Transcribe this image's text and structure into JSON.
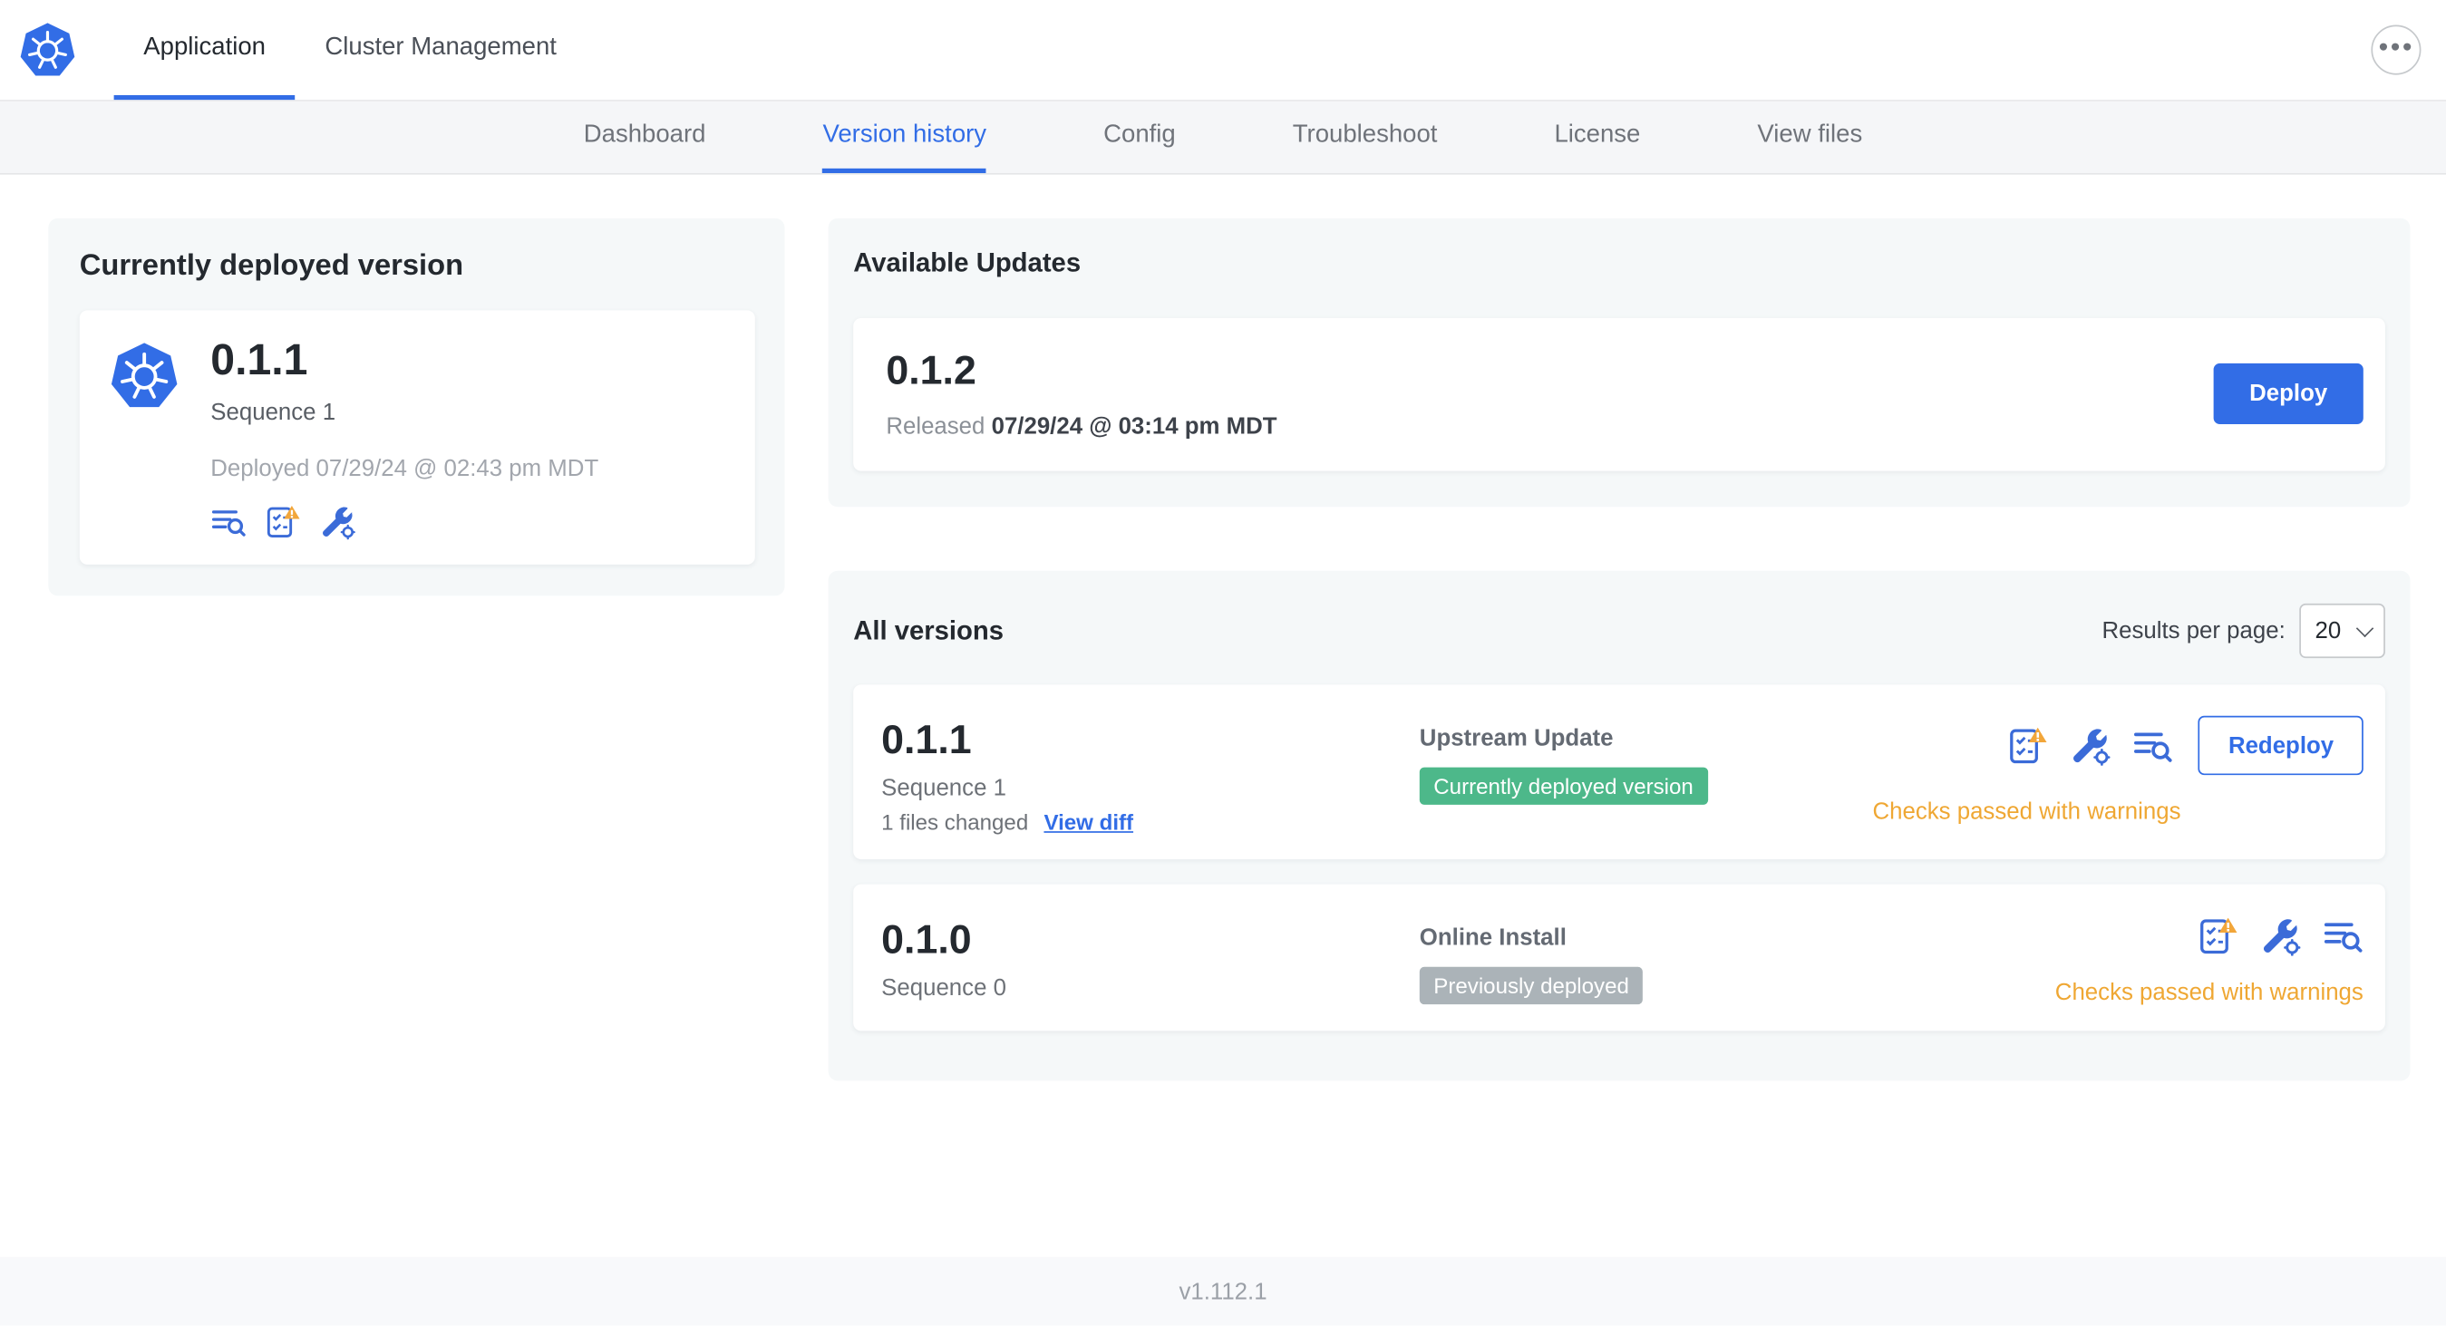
{
  "colors": {
    "accent_blue": "#326de6",
    "badge_green": "#4db88a",
    "badge_gray": "#abb3b8",
    "warning_orange": "#efa733"
  },
  "icons": {
    "logo": "kubernetes-logo",
    "more": "ellipsis-icon",
    "release_notes": "release-notes-icon",
    "preflight": "preflight-checks-warning-icon",
    "config": "config-wrench-icon",
    "select_chevron": "chevron-down-icon"
  },
  "topnav": {
    "tabs": [
      {
        "label": "Application",
        "active": true
      },
      {
        "label": "Cluster Management",
        "active": false
      }
    ]
  },
  "subnav": {
    "items": [
      {
        "label": "Dashboard",
        "active": false
      },
      {
        "label": "Version history",
        "active": true
      },
      {
        "label": "Config",
        "active": false
      },
      {
        "label": "Troubleshoot",
        "active": false
      },
      {
        "label": "License",
        "active": false
      },
      {
        "label": "View files",
        "active": false
      }
    ]
  },
  "current_version": {
    "title": "Currently deployed version",
    "version": "0.1.1",
    "sequence": "Sequence 1",
    "deployed": "Deployed 07/29/24 @ 02:43 pm MDT"
  },
  "available_updates": {
    "title": "Available Updates",
    "version": "0.1.2",
    "released_label": "Released",
    "released_date": "07/29/24 @ 03:14 pm MDT",
    "deploy_button": "Deploy"
  },
  "all_versions": {
    "title": "All versions",
    "results_per_page_label": "Results per page:",
    "results_per_page_value": "20",
    "rows": [
      {
        "version": "0.1.1",
        "sequence": "Sequence 1",
        "files_changed": "1 files changed",
        "view_diff_link": "View diff",
        "source_type": "Upstream Update",
        "badge": "Currently deployed version",
        "badge_type": "green",
        "status": "Checks passed with warnings",
        "action_button": "Redeploy"
      },
      {
        "version": "0.1.0",
        "sequence": "Sequence 0",
        "source_type": "Online Install",
        "badge": "Previously deployed",
        "badge_type": "gray",
        "status": "Checks passed with warnings"
      }
    ]
  },
  "footer": {
    "version_label": "v1.112.1"
  }
}
